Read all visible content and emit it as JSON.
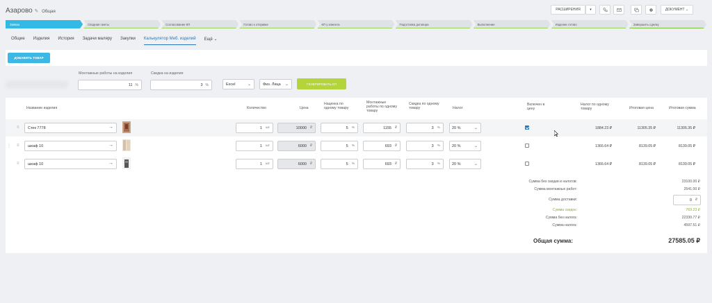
{
  "header": {
    "title": "Азарово",
    "subtitle": "Общая",
    "btn_extensions": "РАСШИРЕНИЯ",
    "btn_document": "ДОКУМЕНТ"
  },
  "stages": [
    "Заявка",
    "Сводная сметы",
    "Согласование КП",
    "Готово к отправке",
    "КП у клиента",
    "Подготовка договора",
    "Выполнение",
    "Изделие готово",
    "Завершить сделку"
  ],
  "tabs": [
    "Общие",
    "Изделия",
    "История",
    "Задачи маляру",
    "Закупки",
    "Калькулятор Меб. изделий",
    "Ещё"
  ],
  "toolbar": {
    "add_button": "ДОБАВИТЬ ТОВАР",
    "mount_label": "Монтажные работы на изделия",
    "mount_value": "11",
    "mount_unit": "%",
    "discount_label": "Скидка на изделия",
    "discount_value": "3",
    "discount_unit": "%",
    "format_select": "Excel",
    "client_select": "Физ. Лица",
    "generate_button": "ГЕНЕРИРОВАТЬ КП"
  },
  "columns": {
    "name": "Название изделия",
    "qty": "Количество",
    "price": "Цена",
    "markup": "Наценка по одному товару",
    "mount": "Монтажные работы по одному товару",
    "discount": "Скидка по одному товару",
    "tax": "Налог",
    "included": "Включен в цену",
    "tax_per_item": "Налог по одному товару",
    "final_price": "Итоговая цена",
    "final_sum": "Итоговая сумма"
  },
  "rows": [
    {
      "name": "Стек 7778",
      "qty": "1",
      "qty_unit": "шт",
      "price": "10000",
      "price_unit": "₽",
      "markup": "5",
      "markup_unit": "%",
      "mount": "1155",
      "mount_unit": "₽",
      "discount": "3",
      "discount_unit": "%",
      "tax": "20 %",
      "included": true,
      "tax_item": "1884.23 ₽",
      "final_price": "11305.35 ₽",
      "final_sum": "11305.35 ₽"
    },
    {
      "name": "шкаф 10",
      "qty": "1",
      "qty_unit": "шт",
      "price": "6000",
      "price_unit": "₽",
      "markup": "5",
      "markup_unit": "%",
      "mount": "693",
      "mount_unit": "₽",
      "discount": "3",
      "discount_unit": "%",
      "tax": "20 %",
      "included": false,
      "tax_item": "1366.64 ₽",
      "final_price": "8139.05 ₽",
      "final_sum": "8139.05 ₽"
    },
    {
      "name": "шкаф 10",
      "qty": "1",
      "qty_unit": "шт",
      "price": "6000",
      "price_unit": "₽",
      "markup": "5",
      "markup_unit": "%",
      "mount": "693",
      "mount_unit": "₽",
      "discount": "3",
      "discount_unit": "%",
      "tax": "20 %",
      "included": false,
      "tax_item": "1366.64 ₽",
      "final_price": "8139.05 ₽",
      "final_sum": "8139.05 ₽"
    }
  ],
  "summary": {
    "no_discount_label": "Сумма без скидки и налогов:",
    "no_discount_value": "23100.00 ₽",
    "mount_label": "Сумма монтажных работ:",
    "mount_value": "2541.00 ₽",
    "delivery_label": "Сумма доставки:",
    "delivery_value": "0",
    "delivery_unit": "₽",
    "discount_label": "Сумма скидок:",
    "discount_value": "769.23 ₽",
    "no_tax_label": "Сумма без налога:",
    "no_tax_value": "22330.77 ₽",
    "tax_label": "Сумма налога:",
    "tax_value": "4597.51 ₽",
    "total_label": "Общая сумма:",
    "total_value": "27585.05 ₽"
  },
  "colors": {
    "accent": "#3bb8e5",
    "green_button": "#b3d43a",
    "link": "#2a76b8"
  }
}
